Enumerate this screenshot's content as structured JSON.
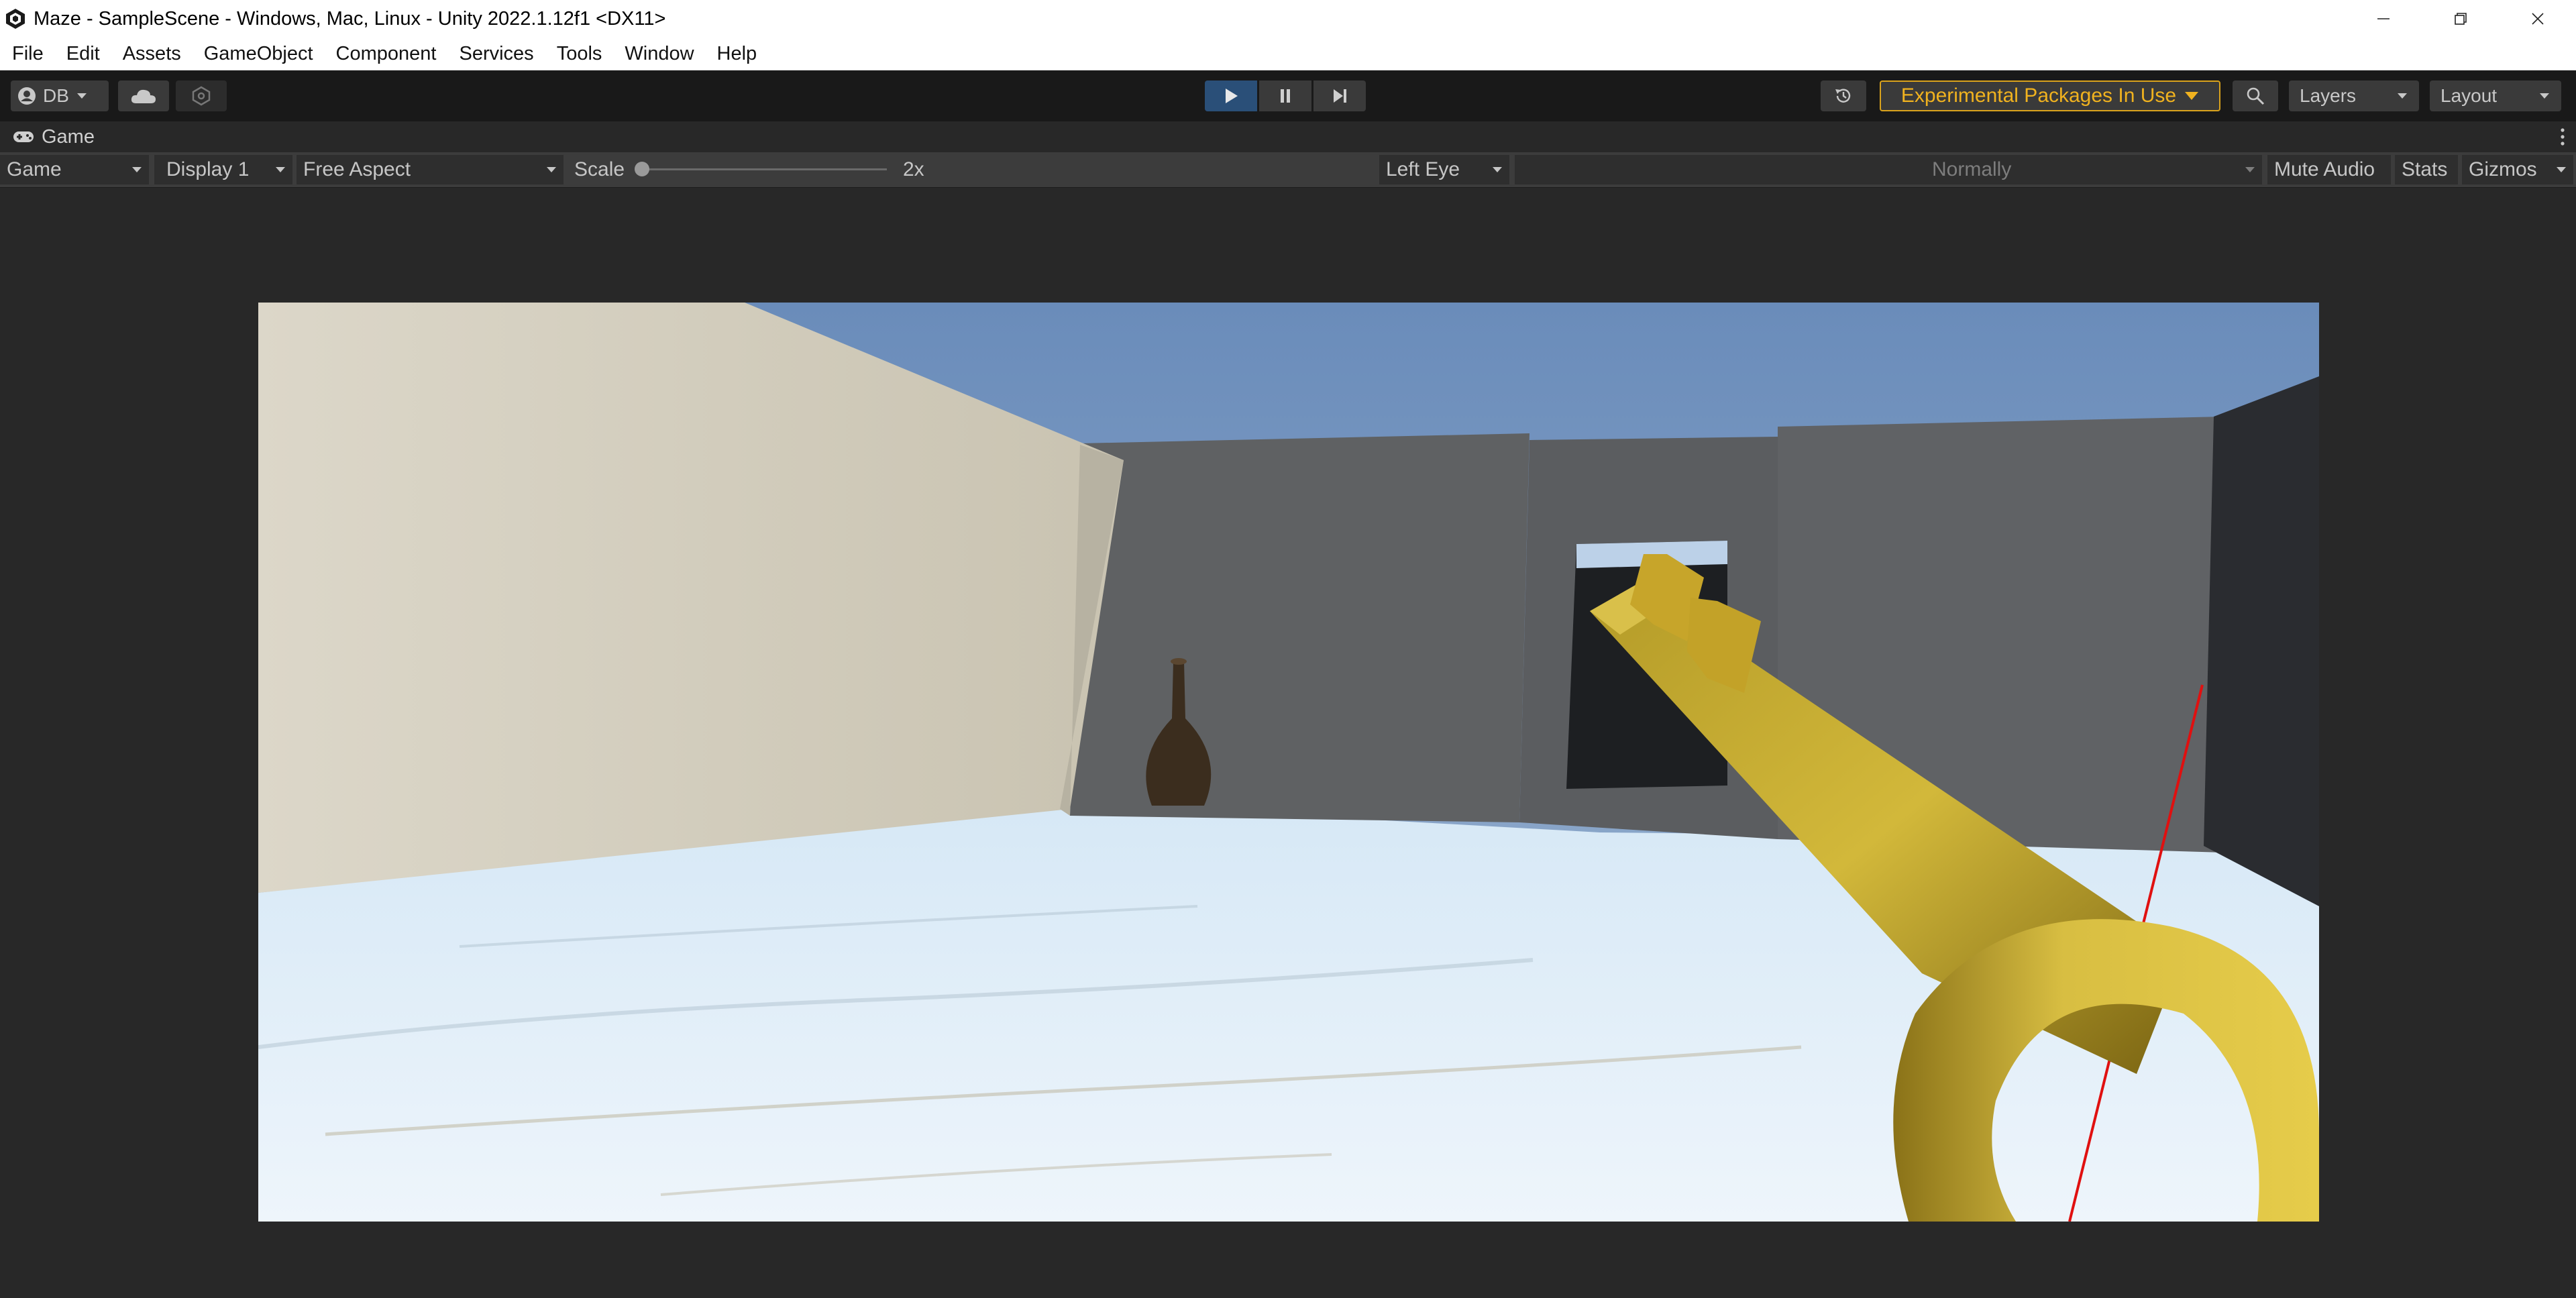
{
  "window": {
    "title": "Maze - SampleScene - Windows, Mac, Linux - Unity 2022.1.12f1 <DX11>"
  },
  "menu": [
    "File",
    "Edit",
    "Assets",
    "GameObject",
    "Component",
    "Services",
    "Tools",
    "Window",
    "Help"
  ],
  "toolbar": {
    "account_label": "DB",
    "experimental_label": "Experimental Packages In Use",
    "layers_label": "Layers",
    "layout_label": "Layout",
    "experimental_color": "#f0b21f",
    "play_active_color": "#2a4f78"
  },
  "game_tab": {
    "label": "Game"
  },
  "game_options": {
    "view": "Game",
    "display": "Display 1",
    "aspect": "Free Aspect",
    "scale_label": "Scale",
    "scale_value": "2x",
    "eye": "Left Eye",
    "mode": "Normally",
    "mute": "Mute Audio",
    "stats": "Stats",
    "gizmos": "Gizmos"
  },
  "icons": [
    "unity-logo-icon",
    "minimize-icon",
    "restore-icon",
    "close-icon",
    "account-icon",
    "cloud-icon",
    "collab-icon",
    "play-icon",
    "pause-icon",
    "step-icon",
    "history-icon",
    "search-icon",
    "gamepad-icon",
    "kebab-menu-icon"
  ]
}
